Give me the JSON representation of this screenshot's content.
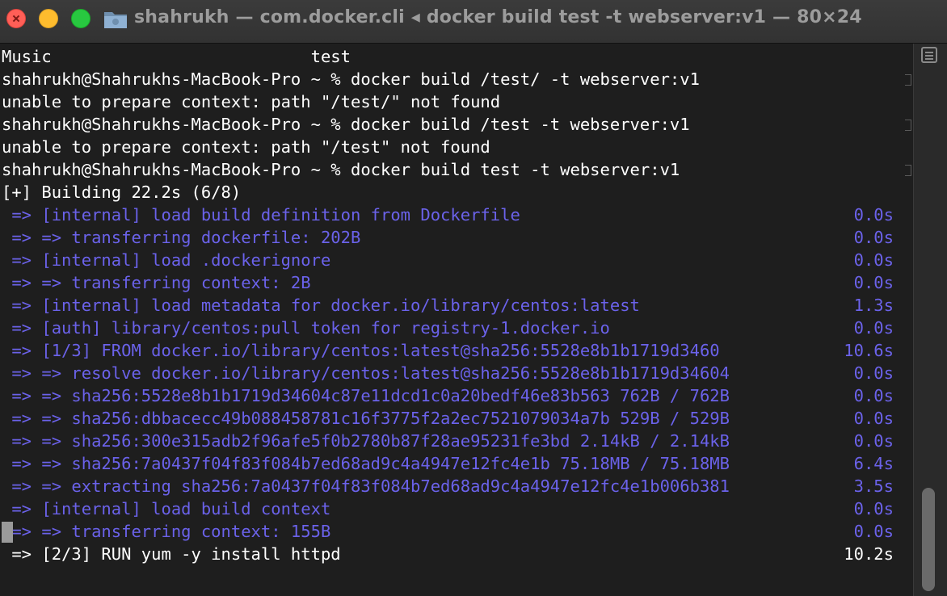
{
  "window": {
    "title": "shahrukh — com.docker.cli ◂ docker build test -t webserver:v1 — 80×24"
  },
  "terminal": {
    "lines": [
      {
        "text": "Music                          test",
        "color": "white"
      },
      {
        "text": "shahrukh@Shahrukhs-MacBook-Pro ~ % docker build /test/ -t webserver:v1",
        "color": "white"
      },
      {
        "text": "unable to prepare context: path \"/test/\" not found",
        "color": "white"
      },
      {
        "text": "shahrukh@Shahrukhs-MacBook-Pro ~ % docker build /test -t webserver:v1",
        "color": "white"
      },
      {
        "text": "unable to prepare context: path \"/test\" not found",
        "color": "white"
      },
      {
        "text": "shahrukh@Shahrukhs-MacBook-Pro ~ % docker build test -t webserver:v1",
        "color": "white"
      },
      {
        "text": "[+] Building 22.2s (6/8)",
        "color": "white"
      },
      {
        "text": " => [internal] load build definition from Dockerfile",
        "time": "0.0s",
        "color": "blue"
      },
      {
        "text": " => => transferring dockerfile: 202B",
        "time": "0.0s",
        "color": "blue"
      },
      {
        "text": " => [internal] load .dockerignore",
        "time": "0.0s",
        "color": "blue"
      },
      {
        "text": " => => transferring context: 2B",
        "time": "0.0s",
        "color": "blue"
      },
      {
        "text": " => [internal] load metadata for docker.io/library/centos:latest",
        "time": "1.3s",
        "color": "blue"
      },
      {
        "text": " => [auth] library/centos:pull token for registry-1.docker.io",
        "time": "0.0s",
        "color": "blue"
      },
      {
        "text": " => [1/3] FROM docker.io/library/centos:latest@sha256:5528e8b1b1719d3460",
        "time": "10.6s",
        "color": "blue"
      },
      {
        "text": " => => resolve docker.io/library/centos:latest@sha256:5528e8b1b1719d34604",
        "time": "0.0s",
        "color": "blue"
      },
      {
        "text": " => => sha256:5528e8b1b1719d34604c87e11dcd1c0a20bedf46e83b563 762B / 762B",
        "time": "0.0s",
        "color": "blue"
      },
      {
        "text": " => => sha256:dbbacecc49b088458781c16f3775f2a2ec7521079034a7b 529B / 529B",
        "time": "0.0s",
        "color": "blue"
      },
      {
        "text": " => => sha256:300e315adb2f96afe5f0b2780b87f28ae95231fe3bd 2.14kB / 2.14kB",
        "time": "0.0s",
        "color": "blue"
      },
      {
        "text": " => => sha256:7a0437f04f83f084b7ed68ad9c4a4947e12fc4e1b 75.18MB / 75.18MB",
        "time": "6.4s",
        "color": "blue"
      },
      {
        "text": " => => extracting sha256:7a0437f04f83f084b7ed68ad9c4a4947e12fc4e1b006b381",
        "time": "3.5s",
        "color": "blue"
      },
      {
        "text": " => [internal] load build context",
        "time": "0.0s",
        "color": "blue"
      },
      {
        "text": " => => transferring context: 155B",
        "time": "0.0s",
        "color": "blue"
      },
      {
        "text": " => [2/3] RUN yum -y install httpd",
        "time": "10.2s",
        "color": "white"
      }
    ]
  },
  "colors": {
    "background": "#1e1e1e",
    "text_white": "#ffffff",
    "text_blue": "#6b62ea",
    "close": "#ff5f57",
    "minimize": "#febc2e",
    "maximize": "#28c840"
  }
}
